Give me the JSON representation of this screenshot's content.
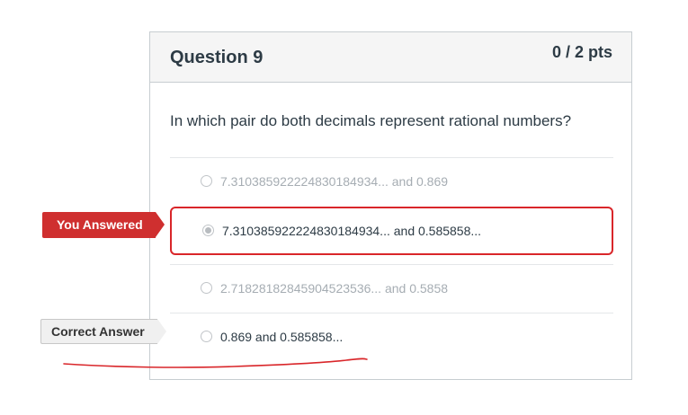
{
  "question": {
    "title": "Question 9",
    "points": "0 / 2 pts",
    "prompt": "In which pair do both decimals represent rational numbers?"
  },
  "answers": [
    {
      "text": "7.31038592222483018493​4... and 0.869",
      "selected": false,
      "correct": false
    },
    {
      "text": "7.31038592222483018493​4... and 0.585858...",
      "selected": true,
      "correct": false
    },
    {
      "text": "2.71828182845904523536... and 0.5858",
      "selected": false,
      "correct": false
    },
    {
      "text": "0.869 and 0.585858...",
      "selected": false,
      "correct": true
    }
  ],
  "flags": {
    "you_answered": "You Answered",
    "correct_answer": "Correct Answer"
  },
  "colors": {
    "incorrect_red": "#cf2f2f",
    "selected_border": "#d9262a",
    "muted_text": "#a6adb3",
    "primary_text": "#2d3b45",
    "annotation_stroke": "#d9262a"
  }
}
